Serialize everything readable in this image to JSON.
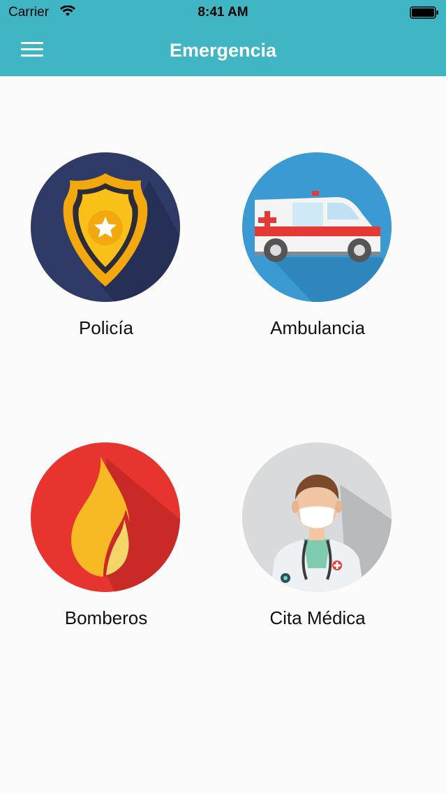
{
  "status_bar": {
    "carrier": "Carrier",
    "time": "8:41 AM"
  },
  "header": {
    "title": "Emergencia",
    "menu_icon": "hamburger-menu-icon"
  },
  "colors": {
    "header_bg": "#40b5c3",
    "title_text": "#ffffff",
    "background": "#fbfbfb"
  },
  "tiles": [
    {
      "label": "Policía",
      "icon": "police-badge-icon",
      "bg": "#2f3a66"
    },
    {
      "label": "Ambulancia",
      "icon": "ambulance-icon",
      "bg": "#3c9ad2"
    },
    {
      "label": "Bomberos",
      "icon": "fire-icon",
      "bg": "#e8342f"
    },
    {
      "label": "Cita Médica",
      "icon": "doctor-icon",
      "bg": "#d9dadb"
    }
  ]
}
